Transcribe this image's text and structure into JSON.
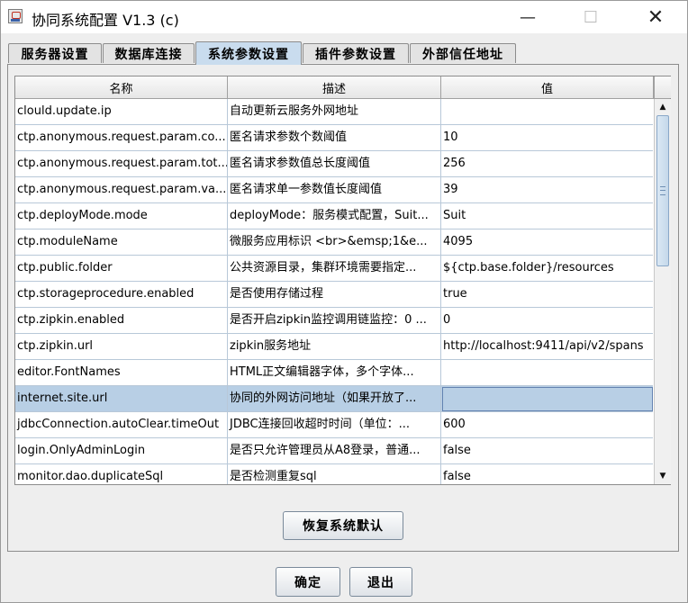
{
  "window": {
    "title": "协同系统配置 V1.3 (c)",
    "minimize_glyph": "—",
    "maximize_glyph": "☐",
    "close_glyph": "✕"
  },
  "tabs": [
    {
      "label": "服务器设置"
    },
    {
      "label": "数据库连接"
    },
    {
      "label": "系统参数设置"
    },
    {
      "label": "插件参数设置"
    },
    {
      "label": "外部信任地址"
    }
  ],
  "active_tab": "系统参数设置",
  "table": {
    "columns": [
      "名称",
      "描述",
      "值"
    ],
    "rows": [
      {
        "name": "clould.update.ip",
        "desc": "自动更新云服务外网地址",
        "value": ""
      },
      {
        "name": "ctp.anonymous.request.param.co...",
        "desc": "匿名请求参数个数阈值",
        "value": "10"
      },
      {
        "name": "ctp.anonymous.request.param.tot...",
        "desc": "匿名请求参数值总长度阈值",
        "value": "256"
      },
      {
        "name": "ctp.anonymous.request.param.va...",
        "desc": "匿名请求单一参数值长度阈值",
        "value": "39"
      },
      {
        "name": "ctp.deployMode.mode",
        "desc": "deployMode：服务模式配置，Suit...",
        "value": "Suit"
      },
      {
        "name": "ctp.moduleName",
        "desc": "微服务应用标识 <br>&emsp;1&e...",
        "value": "4095"
      },
      {
        "name": "ctp.public.folder",
        "desc": "公共资源目录，集群环境需要指定...",
        "value": "${ctp.base.folder}/resources"
      },
      {
        "name": "ctp.storageprocedure.enabled",
        "desc": "是否使用存储过程",
        "value": "true"
      },
      {
        "name": "ctp.zipkin.enabled",
        "desc": "是否开启zipkin监控调用链监控：0 ...",
        "value": "0"
      },
      {
        "name": "ctp.zipkin.url",
        "desc": "zipkin服务地址",
        "value": "http://localhost:9411/api/v2/spans"
      },
      {
        "name": "editor.FontNames",
        "desc": "HTML正文编辑器字体，多个字体...",
        "value": ""
      },
      {
        "name": "internet.site.url",
        "desc": "协同的外网访问地址（如果开放了...",
        "value": ""
      },
      {
        "name": "jdbcConnection.autoClear.timeOut",
        "desc": "JDBC连接回收超时时间（单位：...",
        "value": "600"
      },
      {
        "name": "login.OnlyAdminLogin",
        "desc": "是否只允许管理员从A8登录，普通...",
        "value": "false"
      },
      {
        "name": "monitor.dao.duplicateSql",
        "desc": "是否检测重复sql",
        "value": "false"
      }
    ],
    "selected_row": 11
  },
  "buttons": {
    "restore_default": "恢复系统默认",
    "ok": "确定",
    "exit": "退出"
  }
}
